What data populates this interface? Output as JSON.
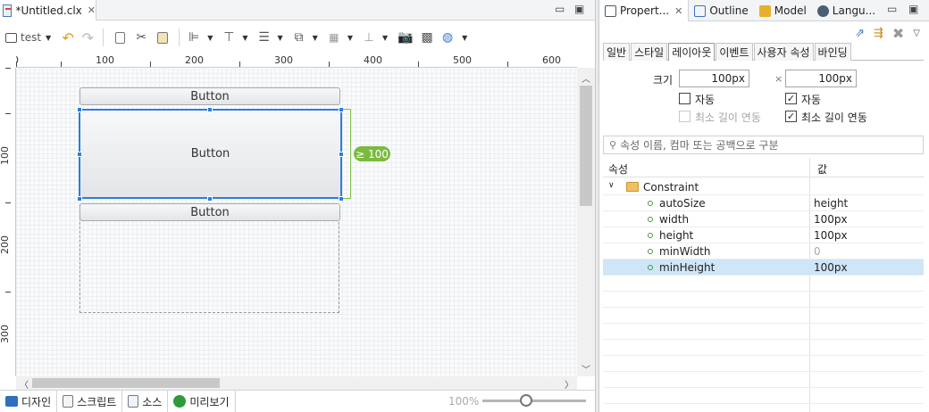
{
  "editor": {
    "tab_title": "*Untitled.clx",
    "toolbar": {
      "target_select": "test"
    },
    "ruler_h": [
      "0",
      "100",
      "200",
      "300",
      "400",
      "500",
      "600"
    ],
    "ruler_v": [
      "100",
      "200",
      "300"
    ],
    "buttons": [
      "Button",
      "Button",
      "Button"
    ],
    "dimension_badge": "≥ 100",
    "bottom_tabs": [
      "디자인",
      "스크립트",
      "소스",
      "미리보기"
    ],
    "zoom": "100%"
  },
  "panel": {
    "tabs": [
      "Propert...",
      "Outline",
      "Model",
      "Langu..."
    ],
    "subtabs": [
      "일반",
      "스타일",
      "레이아웃",
      "이벤트",
      "사용자 속성",
      "바인딩"
    ],
    "size_label": "크기",
    "width_value": "100px",
    "height_value": "100px",
    "times": "×",
    "auto_label_1": "자동",
    "auto_label_2": "자동",
    "min_link_1": "최소 길이 연동",
    "min_link_2": "최소 길이 연동",
    "search_placeholder": "속성 이름, 컴마 또는 공백으로 구분",
    "columns": [
      "속성",
      "값"
    ],
    "group": "Constraint",
    "rows": [
      {
        "name": "autoSize",
        "value": "height"
      },
      {
        "name": "width",
        "value": "100px"
      },
      {
        "name": "height",
        "value": "100px"
      },
      {
        "name": "minWidth",
        "value": "0"
      },
      {
        "name": "minHeight",
        "value": "100px"
      }
    ]
  }
}
